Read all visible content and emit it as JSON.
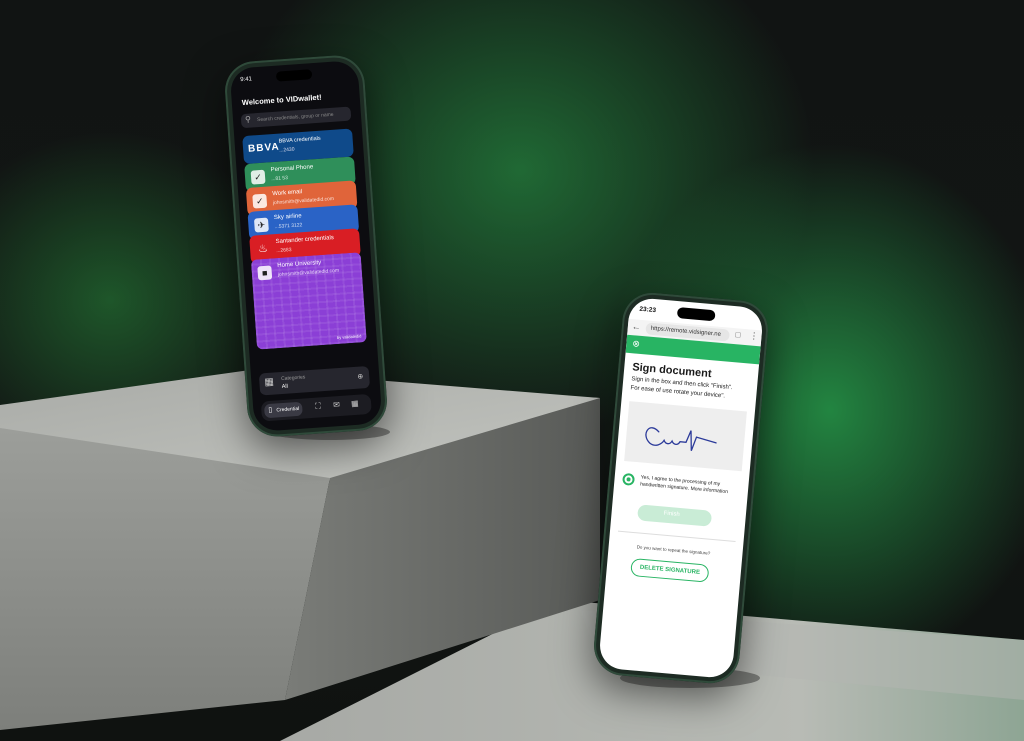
{
  "left_phone": {
    "time": "9:41",
    "title": "Welcome to VIDwallet!",
    "search_placeholder": "Search credentials, group or name",
    "cards": [
      {
        "brand": "BBVA",
        "line1": "BBVA credentials",
        "line2": "...2430",
        "color": "#0f4a8a",
        "icon": "bbva-logo-icon"
      },
      {
        "line1": "Personal Phone",
        "line2": "...81 53",
        "color": "#2f8f5a",
        "icon": "vid-check-icon"
      },
      {
        "line1": "Work email",
        "line2": "johnsmith@validatedid.com",
        "color": "#e0643a",
        "icon": "vid-check-icon"
      },
      {
        "line1": "Sky airline",
        "line2": "...5371 3122",
        "color": "#2a63c6",
        "icon": "airline-icon"
      },
      {
        "line1": "Santander credentials",
        "line2": "...2683",
        "color": "#d91e24",
        "icon": "santander-flame-icon"
      },
      {
        "line1": "Home University",
        "line2": "johnsmith@validatedid.com",
        "color": "#8b3fd6",
        "icon": "university-icon"
      }
    ],
    "pattern_footer": "by validatedid",
    "category_label": "Categories",
    "category_value": "All",
    "bottom_tab_active": "Credential",
    "bottom_tab_icons": [
      "credential-icon",
      "scan-icon",
      "mail-icon",
      "qr-icon"
    ]
  },
  "right_phone": {
    "time": "23:23",
    "url": "https://remote.vidsigner.ne",
    "heading": "Sign document",
    "instructions_1": "Sign in the box and then click \"Finish\".",
    "instructions_2": "For ease of use rotate your device\".",
    "consent_text": "Yes, I agree to the processing of my handwritten signature. More information",
    "finish_label": "Finish",
    "repeat_prompt": "Do you want to repeat the signature?",
    "delete_label": "DELETE SIGNATURE"
  },
  "colors": {
    "accent_green": "#28b463",
    "background": "#0d0f0e",
    "pedestal": "#9a9c98"
  }
}
